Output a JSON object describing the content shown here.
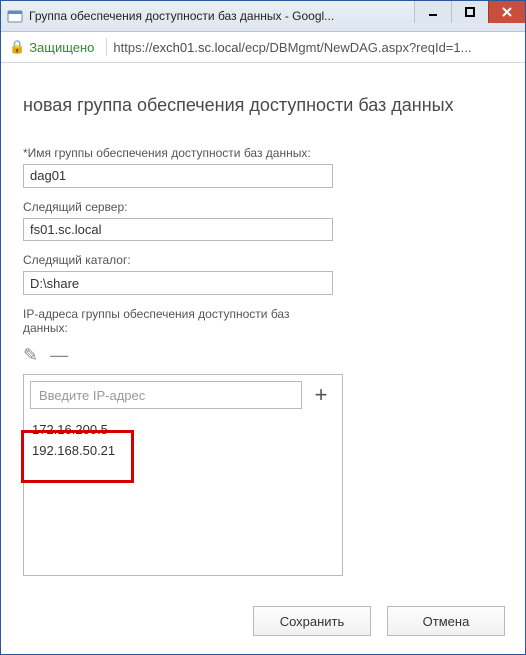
{
  "window": {
    "title": "Группа обеспечения доступности баз данных - Googl..."
  },
  "addressbar": {
    "secure_label": "Защищено",
    "url_prefix": "https://",
    "url_host": "exch01.sc.local",
    "url_path": "/ecp/DBMgmt/NewDAG.aspx?reqId=1..."
  },
  "page": {
    "heading": "новая группа обеспечения доступности баз данных",
    "name_label": "*Имя группы обеспечения доступности баз данных:",
    "name_value": "dag01",
    "witness_server_label": "Следящий сервер:",
    "witness_server_value": "fs01.sc.local",
    "witness_dir_label": "Следящий каталог:",
    "witness_dir_value": "D:\\share",
    "ip_label": "IP-адреса группы обеспечения доступности баз данных:",
    "ip_placeholder": "Введите IP-адрес",
    "ip_list": [
      "172.16.200.5",
      "192.168.50.21"
    ],
    "plus_glyph": "+",
    "edit_glyph": "✎",
    "remove_glyph": "—"
  },
  "footer": {
    "save": "Сохранить",
    "cancel": "Отмена"
  }
}
